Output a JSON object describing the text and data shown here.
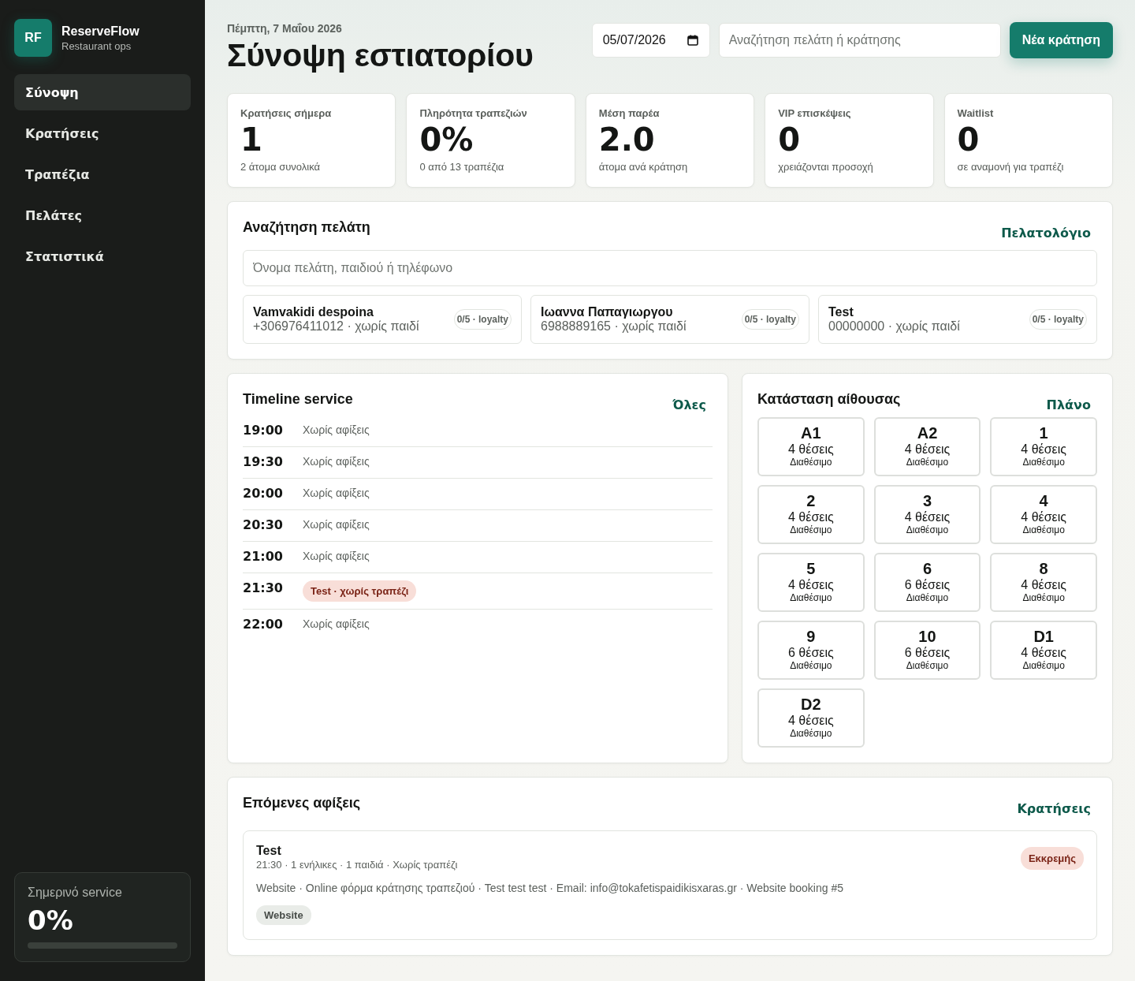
{
  "sidebar": {
    "brand": {
      "logo": "RF",
      "name": "ReserveFlow",
      "tagline": "Restaurant ops"
    },
    "items": [
      {
        "label": "Σύνοψη",
        "selected": true
      },
      {
        "label": "Κρατήσεις",
        "selected": false
      },
      {
        "label": "Τραπέζια",
        "selected": false
      },
      {
        "label": "Πελάτες",
        "selected": false
      },
      {
        "label": "Στατιστικά",
        "selected": false
      }
    ],
    "service_card": {
      "label": "Σημερινό service",
      "value": "0%",
      "level": 0
    }
  },
  "header": {
    "date": "Πέμπτη, 7 Μαΐου 2026",
    "title": "Σύνοψη εστιατορίου",
    "date_field": {
      "value": "05/07/2026"
    },
    "search": {
      "placeholder": "Αναζήτηση πελάτη ή κράτησης"
    },
    "new_button": "Νέα κράτηση"
  },
  "stats": [
    {
      "label": "Κρατήσεις σήμερα",
      "value": "1",
      "note": "2 άτομα συνολικά"
    },
    {
      "label": "Πληρότητα τραπεζιών",
      "value": "0%",
      "note": "0 από 13 τραπέζια"
    },
    {
      "label": "Μέση παρέα",
      "value": "2.0",
      "note": "άτομα ανά κράτηση"
    },
    {
      "label": "VIP επισκέψεις",
      "value": "0",
      "note": "χρειάζονται προσοχή"
    },
    {
      "label": "Waitlist",
      "value": "0",
      "note": "σε αναμονή για τραπέζι"
    }
  ],
  "customer_search": {
    "title": "Αναζήτηση πελάτη",
    "link": "Πελατολόγιο",
    "search": {
      "placeholder": "Όνομα πελάτη, παιδιού ή τηλέφωνο"
    },
    "customers": [
      {
        "name": "Vamvakidi despoina",
        "details": "+306976411012 · χωρίς παιδί",
        "badge": "0/5 · loyalty"
      },
      {
        "name": "Ιωαννα Παπαγιωργου",
        "details": "6988889165 · χωρίς παιδί",
        "badge": "0/5 · loyalty"
      },
      {
        "name": "Test",
        "details": "00000000 · χωρίς παιδί",
        "badge": "0/5 · loyalty"
      }
    ]
  },
  "timeline": {
    "title": "Timeline service",
    "link": "Όλες",
    "slots": [
      {
        "time": "19:00",
        "kind": "empty",
        "text": "Χωρίς αφίξεις"
      },
      {
        "time": "19:30",
        "kind": "empty",
        "text": "Χωρίς αφίξεις"
      },
      {
        "time": "20:00",
        "kind": "empty",
        "text": "Χωρίς αφίξεις"
      },
      {
        "time": "20:30",
        "kind": "empty",
        "text": "Χωρίς αφίξεις"
      },
      {
        "time": "21:00",
        "kind": "empty",
        "text": "Χωρίς αφίξεις"
      },
      {
        "time": "21:30",
        "kind": "booking",
        "text": "Test · χωρίς τραπέζι"
      },
      {
        "time": "22:00",
        "kind": "empty",
        "text": "Χωρίς αφίξεις"
      }
    ]
  },
  "room": {
    "title": "Κατάσταση αίθουσας",
    "link": "Πλάνο",
    "tables": [
      {
        "name": "A1",
        "seats": "4 θέσεις",
        "status": "Διαθέσιμο"
      },
      {
        "name": "A2",
        "seats": "4 θέσεις",
        "status": "Διαθέσιμο"
      },
      {
        "name": "1",
        "seats": "4 θέσεις",
        "status": "Διαθέσιμο"
      },
      {
        "name": "2",
        "seats": "4 θέσεις",
        "status": "Διαθέσιμο"
      },
      {
        "name": "3",
        "seats": "4 θέσεις",
        "status": "Διαθέσιμο"
      },
      {
        "name": "4",
        "seats": "4 θέσεις",
        "status": "Διαθέσιμο"
      },
      {
        "name": "5",
        "seats": "4 θέσεις",
        "status": "Διαθέσιμο"
      },
      {
        "name": "6",
        "seats": "6 θέσεις",
        "status": "Διαθέσιμο"
      },
      {
        "name": "8",
        "seats": "4 θέσεις",
        "status": "Διαθέσιμο"
      },
      {
        "name": "9",
        "seats": "6 θέσεις",
        "status": "Διαθέσιμο"
      },
      {
        "name": "10",
        "seats": "6 θέσεις",
        "status": "Διαθέσιμο"
      },
      {
        "name": "D1",
        "seats": "4 θέσεις",
        "status": "Διαθέσιμο"
      },
      {
        "name": "D2",
        "seats": "4 θέσεις",
        "status": "Διαθέσιμο"
      }
    ]
  },
  "arrivals": {
    "title": "Επόμενες αφίξεις",
    "link": "Κρατήσεις",
    "items": [
      {
        "name": "Test",
        "summary": "21:30 · 1 ενήλικες · 1 παιδιά · Χωρίς τραπέζι",
        "status": "Εκκρεμής",
        "notes": "Website · Online φόρμα κράτησης τραπεζιού · Test test test · Email: info@tokafetispaidikisxaras.gr · Website booking #5",
        "tags": [
          "Website"
        ]
      }
    ]
  }
}
